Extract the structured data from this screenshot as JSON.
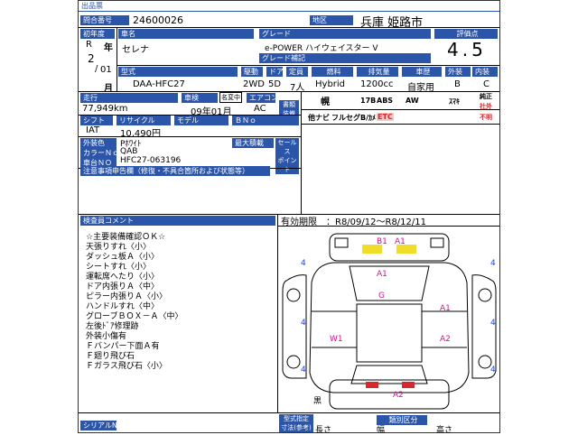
{
  "header": {
    "title": "出品票"
  },
  "lot": {
    "label": "問合番号",
    "value": "24600026"
  },
  "region": {
    "label": "地区",
    "value": "兵庫 姫路市"
  },
  "first_reg": {
    "label": "初年度",
    "era": "R",
    "year": "2",
    "nen": "年",
    "month": "01",
    "tsuki": "月"
  },
  "car_name": {
    "label": "車名",
    "value": "セレナ"
  },
  "grade": {
    "label": "グレード",
    "value": "e-POWER ハイウェイスター V",
    "sub_label": "グレード補記"
  },
  "score": {
    "label": "評価点",
    "value": "4.5"
  },
  "specs": {
    "model_label": "型式",
    "model_value": "DAA-HFC27",
    "drive_label": "駆動",
    "drive_value": "2WD",
    "door_label": "ドア",
    "door_value": "5D",
    "capacity_label": "定員",
    "capacity_value": "7人",
    "fuel_label": "燃料",
    "fuel_value": "Hybrid",
    "displacement_label": "排気量",
    "displacement_value": "1200cc",
    "usage_label": "車歴",
    "usage_value": "自家用",
    "exterior_label": "外装",
    "exterior_value": "B",
    "interior_label": "内装",
    "interior_value": "C"
  },
  "mileage": {
    "label": "走行",
    "value": "77,949km"
  },
  "inspection": {
    "label": "車検",
    "value": "09年01月",
    "badge": "名変中"
  },
  "aircon": {
    "label": "エアコン",
    "value": "AC"
  },
  "document": {
    "label": "書類装備",
    "line1": "書類",
    "line2": "装備"
  },
  "equipment": [
    "幌",
    "17B",
    "ABS",
    "AW",
    "ｽﾏｷ",
    "純正",
    "社外",
    "不明",
    "他ナビ",
    "フルセグ",
    "B/ｶﾒ",
    "ETC"
  ],
  "shift": {
    "label": "シフト",
    "value": "IAT"
  },
  "recycle": {
    "label": "リサイクル",
    "value": "10,490円"
  },
  "model_no": {
    "label": "モデル",
    "value": ""
  },
  "b_no": {
    "label": "ＢＮｏ",
    "value": ""
  },
  "color": {
    "label": "外装色",
    "value": "Pﾎﾜｲﾄ"
  },
  "color_no": {
    "label": "カラーＮｏ",
    "value": "QAB"
  },
  "chassis": {
    "label": "車台ＮＯ",
    "value": "HFC27-063196"
  },
  "max_load": {
    "label": "最大積載"
  },
  "sales_point": {
    "line1": "セールス",
    "line2": "ポイント"
  },
  "notes": {
    "label": "注意事項申告欄（修復・不具合箇所および状態等）"
  },
  "inspector": {
    "label": "検査員コメント",
    "comments": [
      "☆主要装備確認ＯＫ☆",
      "天張りすれ〈小〉",
      "ダッシュ板Ａ〈小〉",
      "シートすれ〈小〉",
      "運転席へたり〈小〉",
      "ドア内張りＡ〈中〉",
      "ピラー内張りＡ〈小〉",
      "ハンドルすれ〈中〉",
      "グローブＢＯＸ－Ａ〈中〉",
      "左後ﾄﾞｱ修理跡",
      "外装小傷有",
      "Ｆバンパー下面Ａ有",
      "Ｆ廻り飛び石",
      "Ｆガラス飛び石〈小〉"
    ]
  },
  "validity": {
    "label": "有効期限",
    "value": "：R8/09/12～R8/12/11"
  },
  "diagram": {
    "marks_mag": [
      "B1",
      "A1",
      "A1",
      "G",
      "A1",
      "W1",
      "A2",
      "A2"
    ],
    "marks_blue": [
      "4",
      "4",
      "4",
      "4",
      "4",
      "4"
    ],
    "note": "黒"
  },
  "footer": {
    "pr_label": "シリアルNo",
    "ninshiki_line1": "型式指定",
    "ninshiki_line2": "寸法(参考)",
    "class_label": "類別区分",
    "length_label": "長さ",
    "width_label": "幅",
    "height_label": "高さ"
  },
  "colors": {
    "header_blue": "#2b55a8",
    "mark_magenta": "#d0138f",
    "mark_blue": "#2244cc",
    "yellow_part": "#f2dc2a",
    "red_part": "#d9282b"
  }
}
